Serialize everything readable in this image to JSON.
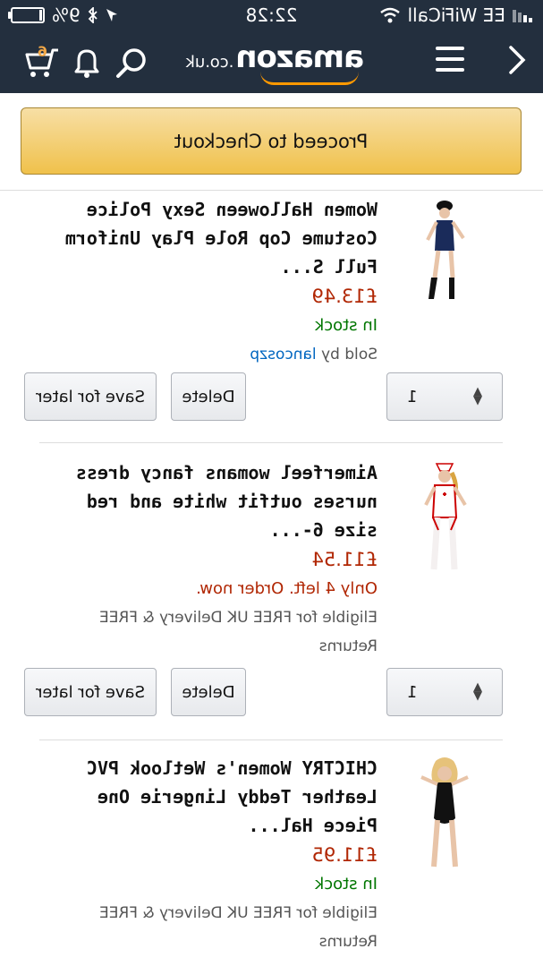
{
  "status_bar": {
    "carrier": "EE WiFiCall",
    "time": "22:28",
    "battery_percent": "9%",
    "icons": [
      "signal-icon",
      "wifi-icon",
      "location-icon",
      "bluetooth-icon",
      "battery-icon"
    ]
  },
  "nav": {
    "logo_word": "amazon",
    "logo_tld": ".co.uk",
    "cart_count": "6",
    "icons": [
      "back-chevron-icon",
      "menu-icon",
      "search-icon",
      "bell-icon",
      "cart-icon"
    ]
  },
  "checkout_label": "Proceed to Checkout",
  "items": [
    {
      "title": "Women Halloween Sexy Police Costume Cop Role Play Uniform Full S...",
      "price": "£13.49",
      "availability": "In stock",
      "availability_color": "#007600",
      "sold_by_prefix": "Sold by",
      "seller": "lancoszp",
      "quantity": "1",
      "delete_label": "Delete",
      "save_label": "Save for later"
    },
    {
      "title": "Aimerfeel womans fancy dress nurses outfit white and red size 6-...",
      "price": "£11.54",
      "availability": "Only 4 left. Order now.",
      "availability_color": "#b12704",
      "delivery": "Eligible for FREE UK Delivery & FREE Returns",
      "quantity": "1",
      "delete_label": "Delete",
      "save_label": "Save for later"
    },
    {
      "title": "CHICTRY Women's Wetlook PVC Leather Teddy Lingerie One Piece Hal...",
      "price": "£11.95",
      "availability": "In stock",
      "availability_color": "#007600",
      "delivery": "Eligible for FREE UK Delivery & FREE Returns"
    }
  ]
}
